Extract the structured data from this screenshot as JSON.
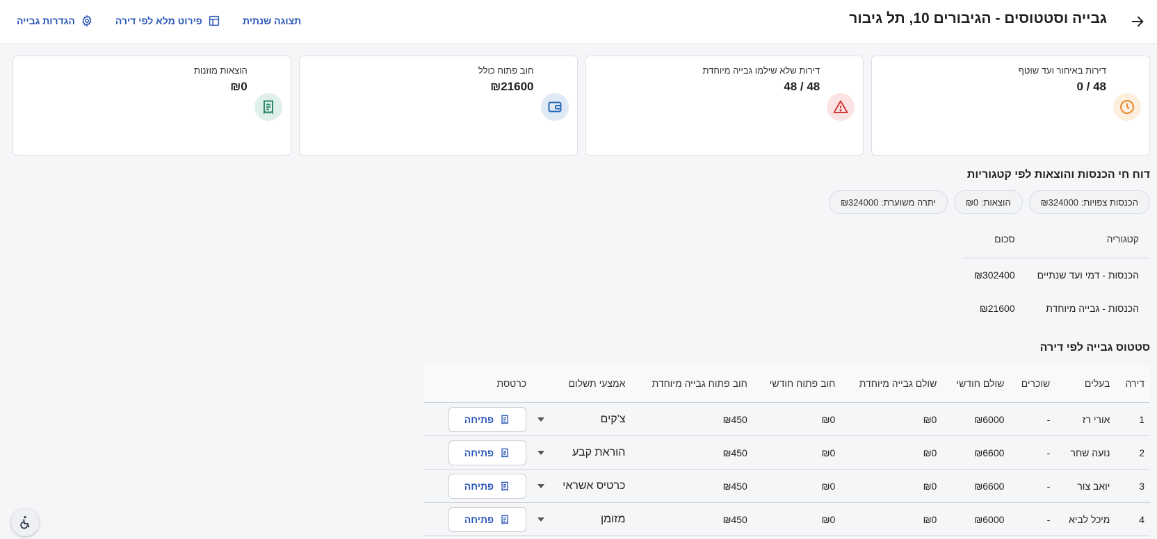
{
  "header": {
    "title": "גבייה וסטטוסים - הגיבורים 10, תל גיבור",
    "actions": {
      "yearly_view": "תצוגה שנתית",
      "full_breakdown": "פירוט מלא לפי דירה",
      "collection_settings": "הגדרות גבייה"
    }
  },
  "cards": [
    {
      "label": "דירות באיחור ועד שוטף",
      "value": "48 / 0",
      "icon": "clock-icon",
      "color": "#e8892b",
      "bg": "#fdeedd"
    },
    {
      "label": "דירות שלא שילמו גבייה מיוחדת",
      "value": "48 / 48",
      "icon": "warning-icon",
      "color": "#d23b3b",
      "bg": "#fbe3e3"
    },
    {
      "label": "חוב פתוח כולל",
      "value": "₪21600",
      "icon": "wallet-icon",
      "color": "#2a6bb8",
      "bg": "#dfeaf6"
    },
    {
      "label": "הוצאות מוזנות",
      "value": "₪0",
      "icon": "receipt-icon",
      "color": "#2b8a6b",
      "bg": "#dff0e8"
    }
  ],
  "report": {
    "title": "דוח חי הכנסות והוצאות לפי קטגוריות",
    "chips": [
      "הכנסות צפויות: ₪324000",
      "הוצאות: ₪0",
      "יתרה משוערת: ₪324000"
    ],
    "columns": {
      "category": "קטגוריה",
      "amount": "סכום"
    },
    "rows": [
      {
        "category": "הכנסות - דמי ועד שנתיים",
        "amount": "₪302400"
      },
      {
        "category": "הכנסות - גבייה מיוחדת",
        "amount": "₪21600"
      }
    ]
  },
  "apartments": {
    "title": "סטטוס גבייה לפי דירה",
    "columns": {
      "apt": "דירה",
      "owners": "בעלים",
      "tenants": "שוכרים",
      "paid_monthly": "שולם חודשי",
      "paid_special": "שולם גבייה מיוחדת",
      "debt_monthly": "חוב פתוח חודשי",
      "debt_special": "חוב פתוח גבייה מיוחדת",
      "payment_method": "אמצעי תשלום",
      "ledger": "כרטסת"
    },
    "open_label": "פתיחה",
    "rows": [
      {
        "apt": "1",
        "owners": "אורי רז",
        "tenants": "-",
        "paid_monthly": "₪6000",
        "paid_special": "₪0",
        "debt_monthly": "₪0",
        "debt_special": "₪450",
        "payment_method": "צ'קים"
      },
      {
        "apt": "2",
        "owners": "נועה שחר",
        "tenants": "-",
        "paid_monthly": "₪6600",
        "paid_special": "₪0",
        "debt_monthly": "₪0",
        "debt_special": "₪450",
        "payment_method": "הוראת קבע"
      },
      {
        "apt": "3",
        "owners": "יואב צור",
        "tenants": "-",
        "paid_monthly": "₪6600",
        "paid_special": "₪0",
        "debt_monthly": "₪0",
        "debt_special": "₪450",
        "payment_method": "כרטיס אשראי"
      },
      {
        "apt": "4",
        "owners": "מיכל לביא",
        "tenants": "-",
        "paid_monthly": "₪6000",
        "paid_special": "₪0",
        "debt_monthly": "₪0",
        "debt_special": "₪450",
        "payment_method": "מזומן"
      }
    ]
  },
  "accessibility": {
    "icon": "accessibility-icon"
  }
}
